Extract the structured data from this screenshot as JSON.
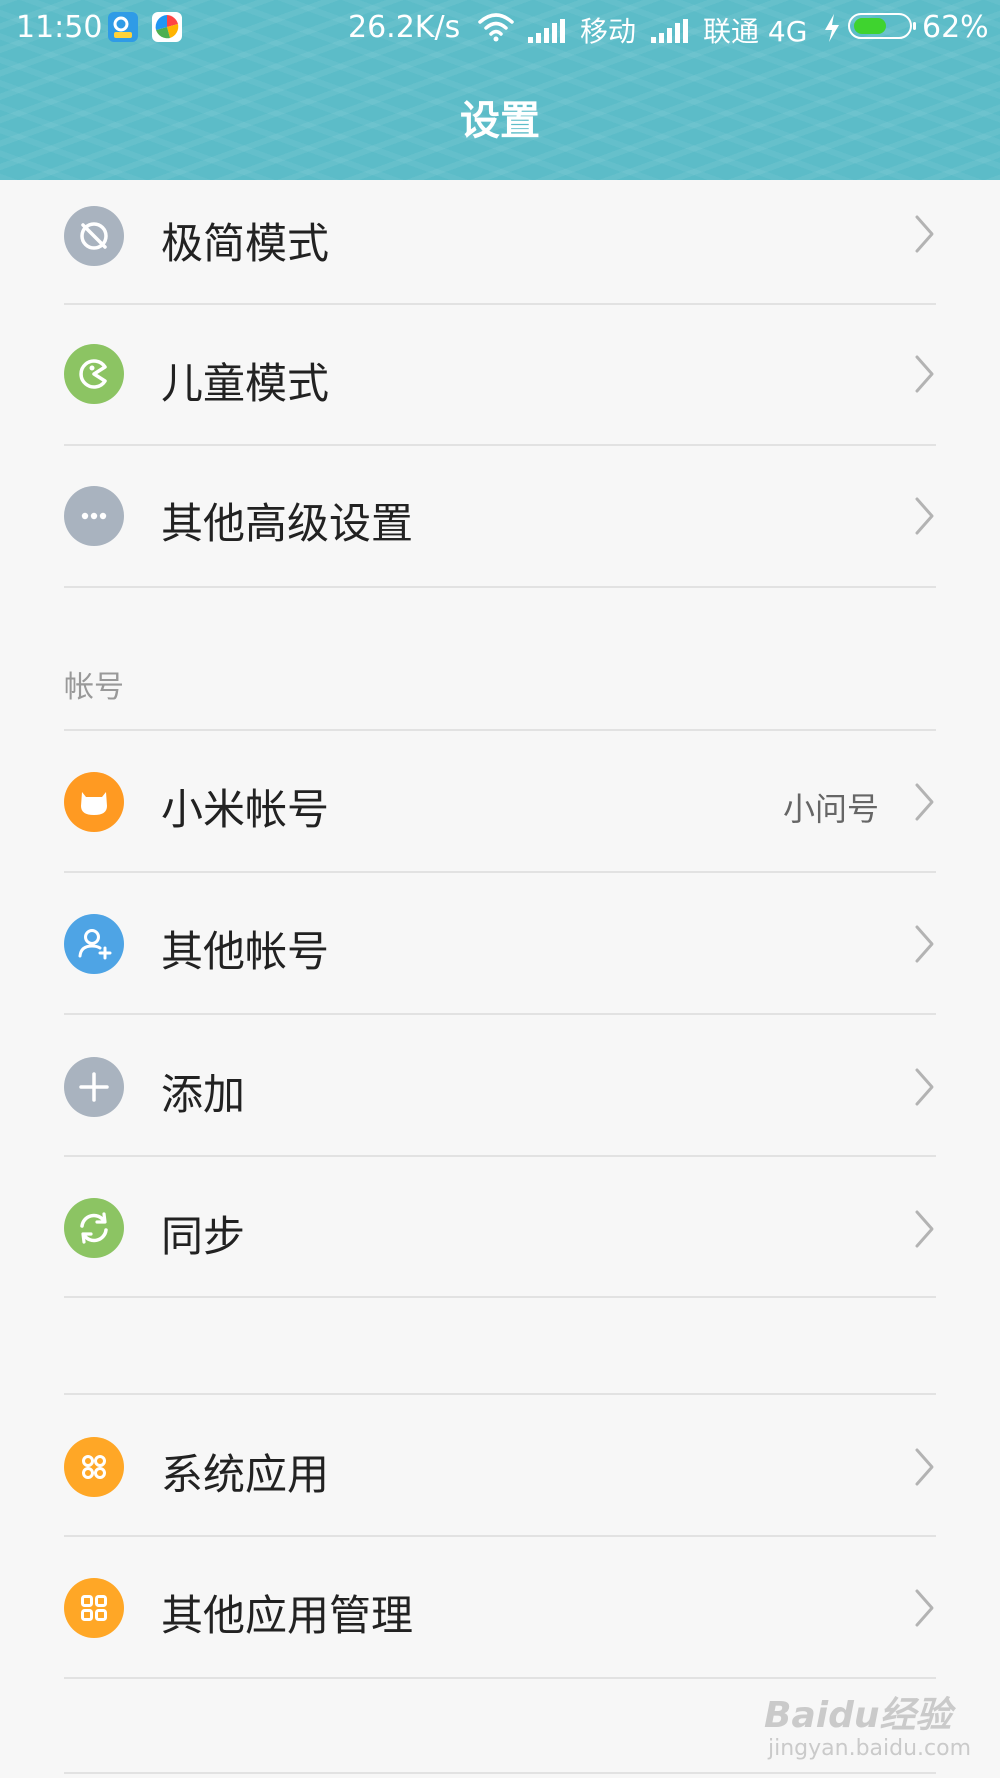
{
  "status_bar": {
    "time": "11:50",
    "net_speed": "26.2K/s",
    "carrier1": "移动",
    "carrier2": "联通 4G",
    "battery_percent": "62%",
    "battery_level": 0.62
  },
  "header": {
    "title": "设置"
  },
  "section1": {
    "items": [
      {
        "label": "极简模式",
        "icon": "minimal-mode-icon",
        "color": "#a9b3bf"
      },
      {
        "label": "儿童模式",
        "icon": "child-mode-icon",
        "color": "#8cc463"
      },
      {
        "label": "其他高级设置",
        "icon": "more-dots-icon",
        "color": "#a9b3bf"
      }
    ]
  },
  "accounts": {
    "header": "帐号",
    "items": [
      {
        "label": "小米帐号",
        "value": "小问号",
        "icon": "mi-account-icon",
        "color": "#ff9a22"
      },
      {
        "label": "其他帐号",
        "icon": "add-person-icon",
        "color": "#4ea4e5"
      },
      {
        "label": "添加",
        "icon": "plus-icon",
        "color": "#a9b3bf"
      },
      {
        "label": "同步",
        "icon": "sync-icon",
        "color": "#8cc463"
      }
    ]
  },
  "apps": {
    "items": [
      {
        "label": "系统应用",
        "icon": "system-apps-icon",
        "color": "#ffa726"
      },
      {
        "label": "其他应用管理",
        "icon": "app-management-icon",
        "color": "#ffa726"
      }
    ]
  },
  "watermark": {
    "text": "Baidu经验",
    "subtext": "jingyan.baidu.com"
  }
}
